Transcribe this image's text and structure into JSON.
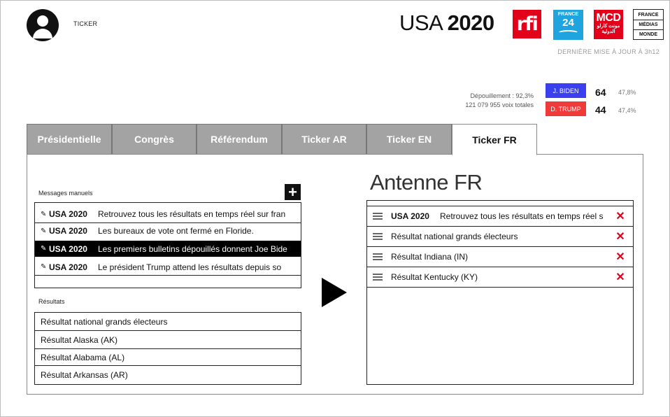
{
  "header": {
    "ticker_label": "TICKER",
    "title_light": "USA ",
    "title_bold": "2020",
    "updated": "DERNIÈRE MISE À JOUR À 3h12",
    "logos": {
      "rfi": "rfi",
      "france24_top": "FRANCE",
      "france24_num": "24",
      "mcd_title": "MCD",
      "mcd_sub": "مونت كارلو الدولية",
      "fmm": [
        "FRANCE",
        "MÉDIAS",
        "MONDE"
      ]
    }
  },
  "stats": {
    "depouillement": "Dépouillement : 92,3%",
    "voix": "121 079 955 voix totales",
    "biden": {
      "label": "J. BIDEN",
      "votes": "64",
      "pct": "47,8%",
      "color": "#3a3ff0"
    },
    "trump": {
      "label": "D. TRUMP",
      "votes": "44",
      "pct": "47,4%",
      "color": "#f03a3a"
    }
  },
  "tabs": [
    "Présidentielle",
    "Congrès",
    "Référendum",
    "Ticker AR",
    "Ticker EN",
    "Ticker FR"
  ],
  "active_tab": "Ticker FR",
  "manual": {
    "label": "Messages manuels",
    "add_icon": "plus-icon",
    "items": [
      {
        "tag": "USA 2020",
        "text": "Retrouvez tous les résultats en temps réel sur fran"
      },
      {
        "tag": "USA 2020",
        "text": "Les bureaux de vote ont fermé en Floride."
      },
      {
        "tag": "USA 2020",
        "text": "Les premiers bulletins dépouillés donnent Joe Bide"
      },
      {
        "tag": "USA 2020",
        "text": "Le président Trump attend les résultats depuis so"
      }
    ]
  },
  "results": {
    "label": "Résultats",
    "items": [
      "Résultat national grands électeurs",
      "Résultat Alaska (AK)",
      "Résultat Alabama (AL)",
      "Résultat Arkansas (AR)"
    ]
  },
  "antenne": {
    "title": "Antenne FR",
    "items": [
      {
        "tag": "USA 2020",
        "text": "Retrouvez tous les résultats en temps réel s"
      },
      {
        "tag": "",
        "text": "Résultat national grands électeurs"
      },
      {
        "tag": "",
        "text": "Résultat Indiana (IN)"
      },
      {
        "tag": "",
        "text": "Résultat Kentucky (KY)"
      }
    ]
  }
}
